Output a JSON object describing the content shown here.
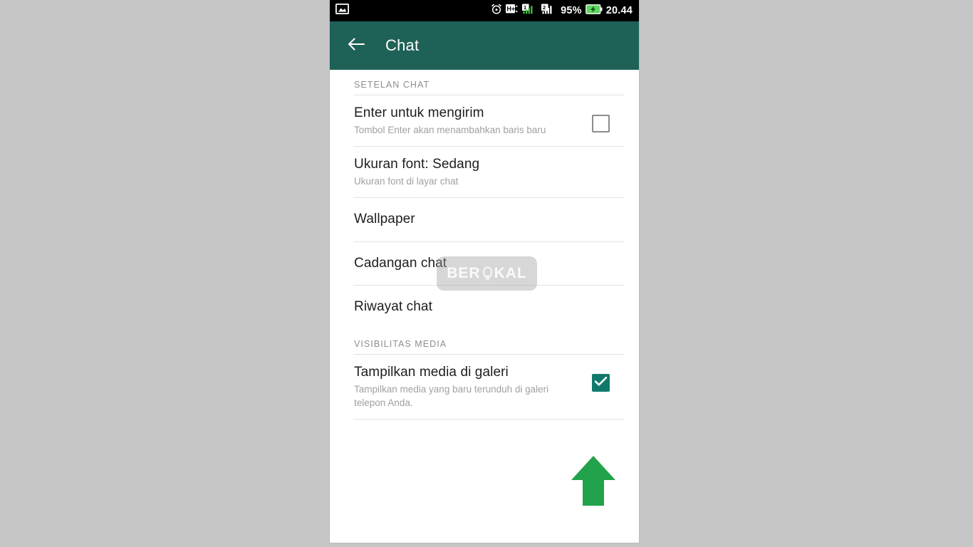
{
  "statusbar": {
    "left_icons": [
      {
        "name": "screenshot-icon"
      }
    ],
    "right_icons": [
      {
        "name": "alarm-clock-icon"
      },
      {
        "name": "hspa-plus-icon"
      },
      {
        "name": "signal-sim1-icon"
      },
      {
        "name": "signal-sim2-icon"
      },
      {
        "name": "battery-charging-icon"
      }
    ],
    "battery_percent": "95%",
    "clock": "20.44"
  },
  "appbar": {
    "back_icon": "arrow-left-icon",
    "title": "Chat",
    "color": "#1e6157"
  },
  "sections": [
    {
      "header": "SETELAN CHAT",
      "rows": [
        {
          "title": "Enter untuk mengirim",
          "subtitle": "Tombol Enter akan menambahkan baris baru",
          "control": "checkbox",
          "checked": false
        },
        {
          "title": "Ukuran font: Sedang",
          "subtitle": "Ukuran font di layar chat",
          "control": "none"
        },
        {
          "title": "Wallpaper",
          "subtitle": "",
          "control": "none"
        },
        {
          "title": "Cadangan chat",
          "subtitle": "",
          "control": "none"
        },
        {
          "title": "Riwayat chat",
          "subtitle": "",
          "control": "none"
        }
      ]
    },
    {
      "header": "VISIBILITAS MEDIA",
      "rows": [
        {
          "title": "Tampilkan media di galeri",
          "subtitle": "Tampilkan media yang baru terunduh di galeri telepon Anda.",
          "control": "checkbox",
          "checked": true
        }
      ]
    }
  ],
  "watermark": {
    "text_before": "BER",
    "logo_icon": "berokal-logo-icon",
    "text_after": "KAL"
  },
  "annotation": {
    "arrow_icon": "up-arrow-icon",
    "color": "#22a24a"
  },
  "colors": {
    "appbar": "#1e6157",
    "checkbox_checked": "#0f7a6c",
    "arrow_green": "#22a24a",
    "page_background": "#c6c6c6"
  }
}
